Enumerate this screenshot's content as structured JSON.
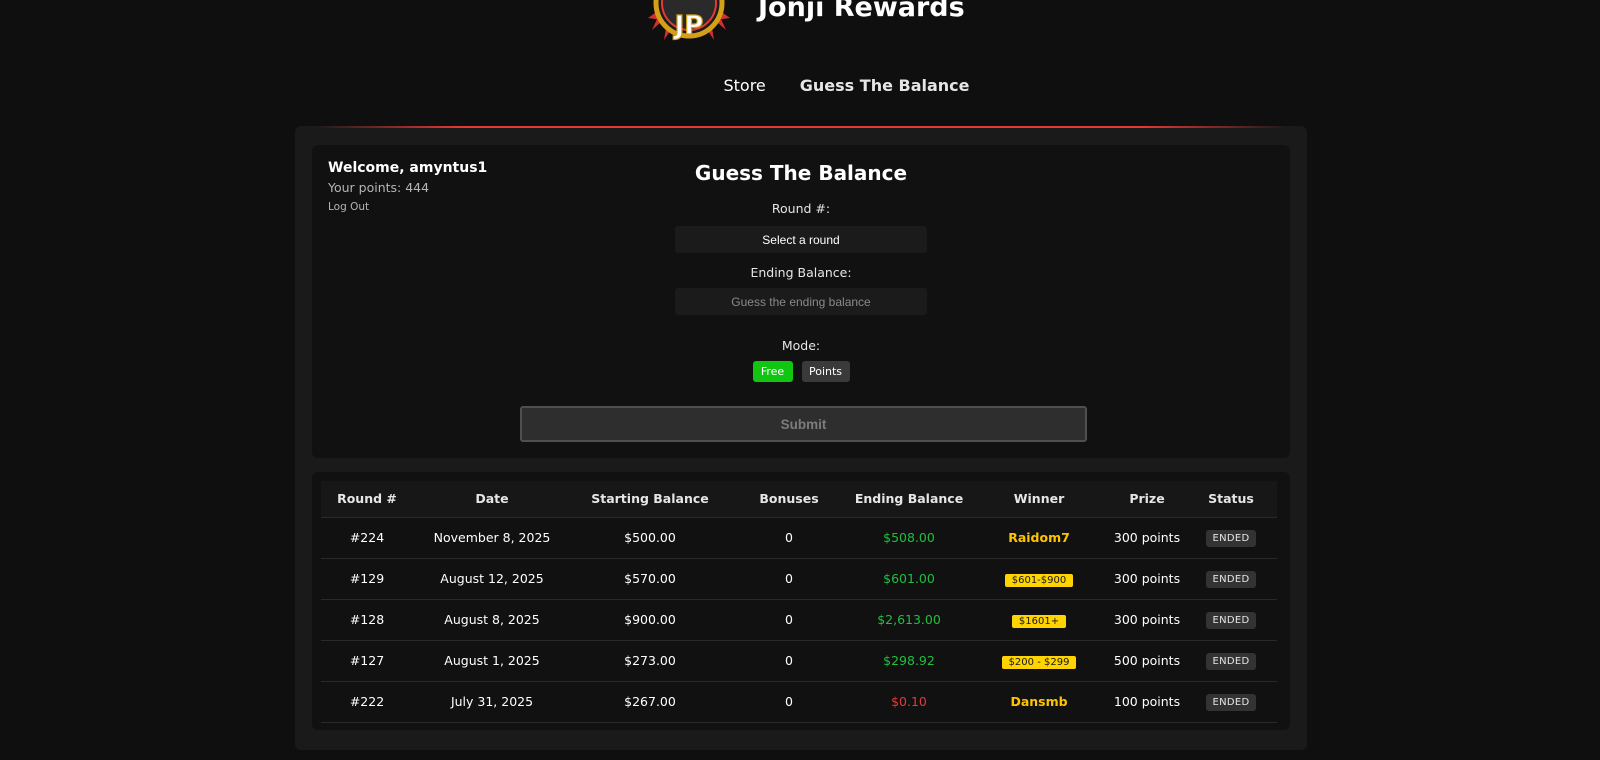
{
  "header": {
    "logo_alt": "JP",
    "title": "Jonji Rewards"
  },
  "nav": {
    "items": [
      {
        "label": "Store"
      },
      {
        "label": "Guess The Balance"
      }
    ]
  },
  "user": {
    "welcome": "Welcome, amyntus1",
    "points": "Your points: 444",
    "logout": "Log Out"
  },
  "form": {
    "title": "Guess The Balance",
    "round_label": "Round #:",
    "round_select": "Select a round",
    "ending_label": "Ending Balance:",
    "ending_placeholder": "Guess the ending balance",
    "mode_label": "Mode:",
    "mode_free": "Free",
    "mode_points": "Points",
    "submit": "Submit"
  },
  "table": {
    "headers": [
      "Round #",
      "Date",
      "Starting Balance",
      "Bonuses",
      "Ending Balance",
      "Winner",
      "Prize",
      "Status"
    ],
    "rows": [
      {
        "round": "#224",
        "date": "November 8, 2025",
        "start": "$500.00",
        "bonuses": "0",
        "end": "$508.00",
        "winner": "Raidom7",
        "prize": "300 points",
        "status": "ENDED"
      },
      {
        "round": "#129",
        "date": "August 12, 2025",
        "start": "$570.00",
        "bonuses": "0",
        "end": "$601.00",
        "winner": "$601-$900",
        "prize": "300 points",
        "status": "ENDED"
      },
      {
        "round": "#128",
        "date": "August 8, 2025",
        "start": "$900.00",
        "bonuses": "0",
        "end": "$2,613.00",
        "winner": "$1601+",
        "prize": "300 points",
        "status": "ENDED"
      },
      {
        "round": "#127",
        "date": "August 1, 2025",
        "start": "$273.00",
        "bonuses": "0",
        "end": "$298.92",
        "winner": "$200 - $299",
        "prize": "500 points",
        "status": "ENDED"
      },
      {
        "round": "#222",
        "date": "July 31, 2025",
        "start": "$267.00",
        "bonuses": "0",
        "end": "$0.10",
        "winner": "Dansmb",
        "prize": "100 points",
        "status": "ENDED"
      }
    ]
  },
  "colors": {
    "accent_red": "#e53935",
    "free_green": "#10c610",
    "balance_green": "#1fbf3f",
    "winner_yellow": "#ffc400"
  }
}
